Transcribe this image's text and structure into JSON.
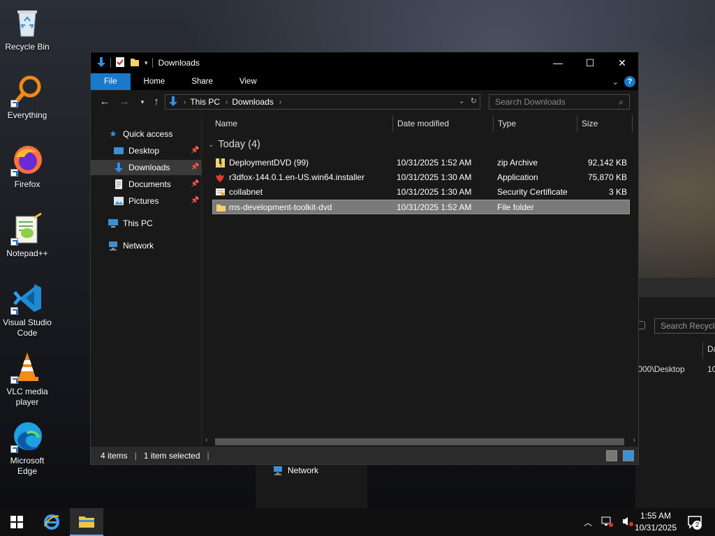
{
  "desktop": {
    "icons": [
      {
        "label": "Recycle Bin"
      },
      {
        "label": "Everything"
      },
      {
        "label": "Firefox"
      },
      {
        "label": "Notepad++"
      },
      {
        "label": "Visual Studio Code"
      },
      {
        "label": "VLC media player"
      },
      {
        "label": "Microsoft Edge"
      }
    ]
  },
  "background_window": {
    "search_placeholder": "Search Recycle Bin",
    "column_partial": "Da",
    "row_path_partial": ".000\\Desktop",
    "row_value_partial": "10",
    "nav_network": "Network"
  },
  "window": {
    "title": "Downloads",
    "ribbon_tabs": [
      "File",
      "Home",
      "Share",
      "View"
    ],
    "breadcrumb": [
      "This PC",
      "Downloads"
    ],
    "search_placeholder": "Search Downloads",
    "nav": {
      "quick_access": "Quick access",
      "desktop": "Desktop",
      "downloads": "Downloads",
      "documents": "Documents",
      "pictures": "Pictures",
      "this_pc": "This PC",
      "network": "Network"
    },
    "columns": {
      "name": "Name",
      "date": "Date modified",
      "type": "Type",
      "size": "Size"
    },
    "group_label": "Today (4)",
    "files": [
      {
        "name": "DeploymentDVD (99)",
        "date": "10/31/2025 1:52 AM",
        "type": "zip Archive",
        "size": "92,142 KB"
      },
      {
        "name": "r3dfox-144.0.1.en-US.win64.installer",
        "date": "10/31/2025 1:30 AM",
        "type": "Application",
        "size": "75,870 KB"
      },
      {
        "name": "collabnet",
        "date": "10/31/2025 1:30 AM",
        "type": "Security Certificate",
        "size": "3 KB"
      },
      {
        "name": "ms-development-toolkit-dvd",
        "date": "10/31/2025 1:52 AM",
        "type": "File folder",
        "size": ""
      }
    ],
    "status": {
      "items": "4 items",
      "selected": "1 item selected"
    }
  },
  "taskbar": {
    "time": "1:55 AM",
    "date": "10/31/2025",
    "notification_count": "2"
  },
  "colors": {
    "accent": "#1979ca",
    "window_bg": "#191919",
    "selection": "#7a7a7a"
  }
}
